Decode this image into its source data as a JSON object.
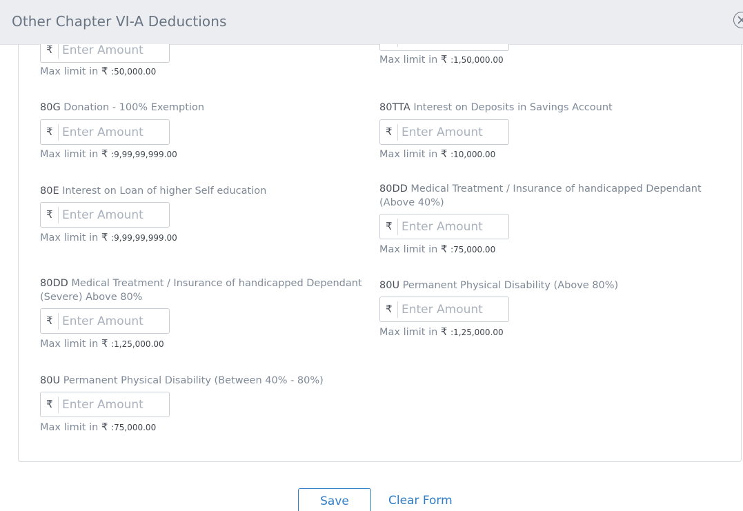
{
  "header": {
    "title": "Other Chapter VI-A Deductions"
  },
  "common": {
    "currency_symbol": "₹",
    "placeholder": "Enter Amount",
    "max_label": "Max limit in",
    "max_colon": ":"
  },
  "fields": {
    "f0": {
      "max": "50,000.00"
    },
    "f1": {
      "max": "1,50,000.00"
    },
    "f2": {
      "code": "80G",
      "desc": "Donation - 100% Exemption",
      "max": "9,99,99,999.00"
    },
    "f3": {
      "code": "80TTA",
      "desc": "Interest on Deposits in Savings Account",
      "max": "10,000.00"
    },
    "f4": {
      "code": "80E",
      "desc": "Interest on Loan of higher Self education",
      "max": "9,99,99,999.00"
    },
    "f5": {
      "code": "80DD",
      "desc": "Medical Treatment / Insurance of handicapped Dependant (Above 40%)",
      "max": "75,000.00"
    },
    "f6": {
      "code": "80DD",
      "desc": "Medical Treatment / Insurance of handicapped Dependant (Severe) Above 80%",
      "max": "1,25,000.00"
    },
    "f7": {
      "code": "80U",
      "desc": "Permanent Physical Disability (Above 80%)",
      "max": "1,25,000.00"
    },
    "f8": {
      "code": "80U",
      "desc": "Permanent Physical Disability (Between 40% - 80%)",
      "max": "75,000.00"
    }
  },
  "footer": {
    "save_label": "Save",
    "clear_label": "Clear Form"
  }
}
